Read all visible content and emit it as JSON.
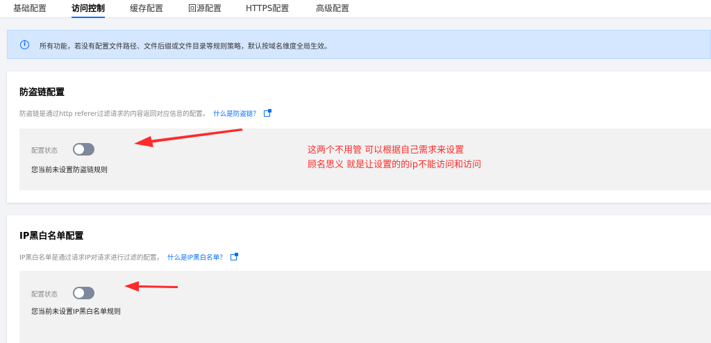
{
  "tabs": [
    {
      "label": "基础配置",
      "active": false
    },
    {
      "label": "访问控制",
      "active": true
    },
    {
      "label": "缓存配置",
      "active": false
    },
    {
      "label": "回源配置",
      "active": false
    },
    {
      "label": "HTTPS配置",
      "active": false
    },
    {
      "label": "高级配置",
      "active": false
    }
  ],
  "notice": {
    "icon": "info-icon",
    "text": "所有功能，若没有配置文件路径、文件后缀或文件目录等规则策略，默认按域名维度全局生效。"
  },
  "referer": {
    "title": "防盗链配置",
    "description": "防盗链是通过http referer过滤请求的内容返回对应信息的配置。",
    "link": "什么是防盗链？",
    "status_label": "配置状态",
    "status_on": false,
    "empty_text": "您当前未设置防盗链规则"
  },
  "ip_filter": {
    "title": "IP黑白名单配置",
    "description": "IP黑白名单是通过请求IP对请求进行过滤的配置。",
    "link": "什么是IP黑白名单？",
    "status_label": "配置状态",
    "status_on": false,
    "empty_text": "您当前未设置IP黑白名单规则"
  },
  "annotation": {
    "line1": "这两个不用管 可以根据自己需求来设置",
    "line2": "顾名思义 就是让设置的的ip不能访问和访问",
    "color": "#ff2a2a"
  },
  "colors": {
    "accent": "#006eff",
    "notice_bg": "#d5e7ff",
    "toggle_off": "#7e889b"
  }
}
